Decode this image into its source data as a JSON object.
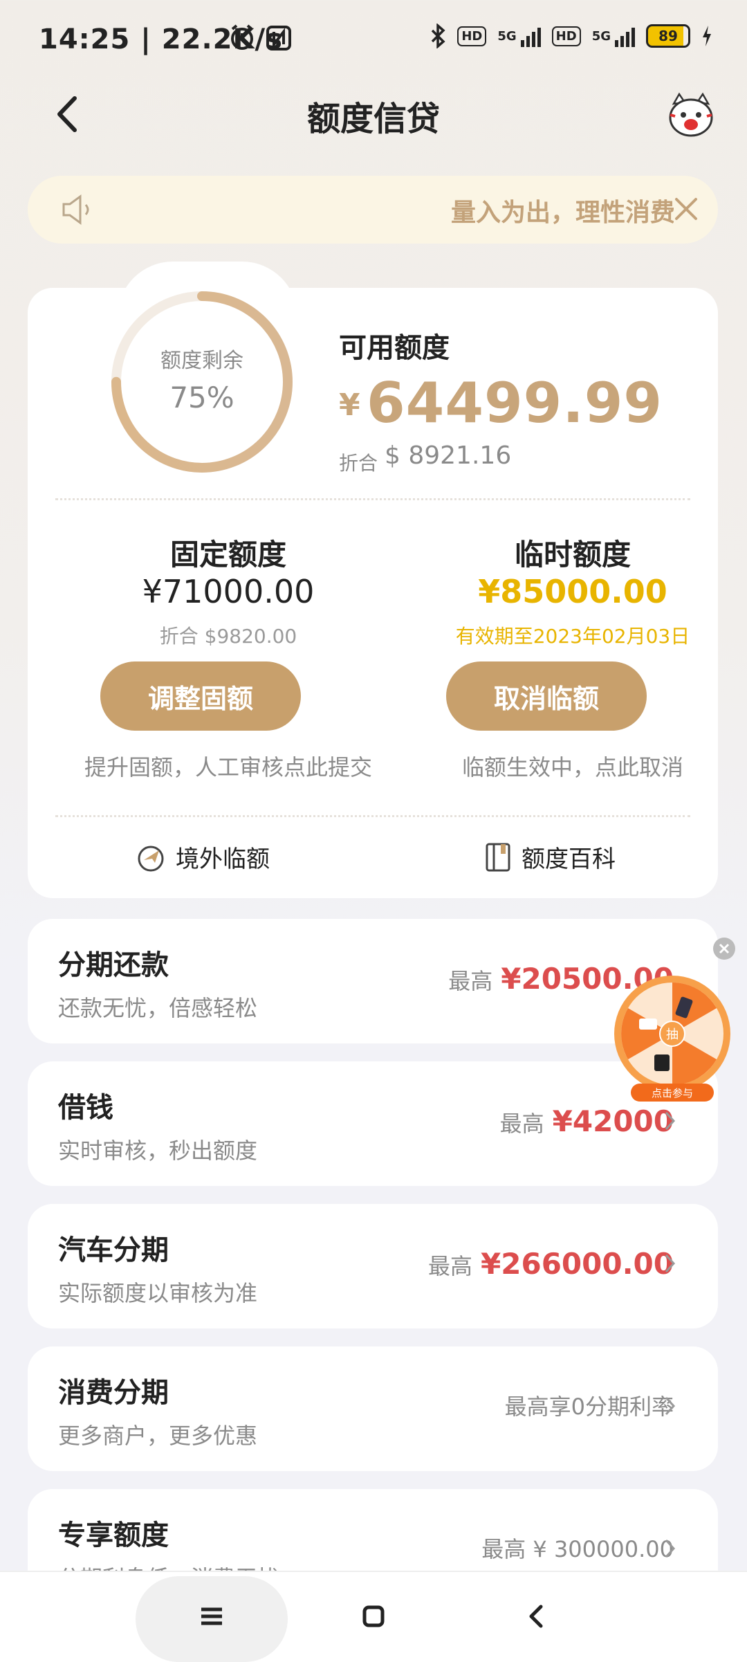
{
  "status_bar": {
    "time": "14:25 | 22.2K/s",
    "hd_label": "HD",
    "network_label": "5G",
    "battery": "89"
  },
  "header": {
    "title": "额度信贷"
  },
  "notice": {
    "text": "量入为出，理性消费"
  },
  "credit": {
    "remaining_label": "额度剩余",
    "remaining_percent": "75%",
    "remaining_fraction": 0.75,
    "available_label": "可用额度",
    "currency_symbol": "¥",
    "available_amount": "64499.99",
    "convert_prefix": "折合",
    "available_usd": "$ 8921.16"
  },
  "fixed": {
    "title": "固定额度",
    "amount": "¥71000.00",
    "convert": "折合 $9820.00",
    "button": "调整固额",
    "hint": "提升固额，人工审核点此提交"
  },
  "temporary": {
    "title": "临时额度",
    "amount": "¥85000.00",
    "validity": "有效期至2023年02月03日",
    "button": "取消临额",
    "hint": "临额生效中，点此取消"
  },
  "tools": {
    "overseas": "境外临额",
    "wiki": "额度百科"
  },
  "products": [
    {
      "title": "分期还款",
      "subtitle": "还款无忧，倍感轻松",
      "prefix": "最高",
      "value": "¥20500.00"
    },
    {
      "title": "借钱",
      "subtitle": "实时审核，秒出额度",
      "prefix": "最高",
      "value": "¥42000"
    },
    {
      "title": "汽车分期",
      "subtitle": "实际额度以审核为准",
      "prefix": "最高",
      "value": "¥266000.00"
    },
    {
      "title": "消费分期",
      "subtitle": "更多商户，更多优惠",
      "plain": "最高享0分期利率"
    },
    {
      "title": "专享额度",
      "subtitle": "分期利息低，消费无忧",
      "plain": "最高 ¥ 300000.00"
    }
  ],
  "wheel": {
    "center_label": "抽",
    "caption": "点击参与"
  },
  "colors": {
    "gold": "#c8a06c",
    "red": "#dc4d4d",
    "temp_gold": "#e8b400"
  }
}
